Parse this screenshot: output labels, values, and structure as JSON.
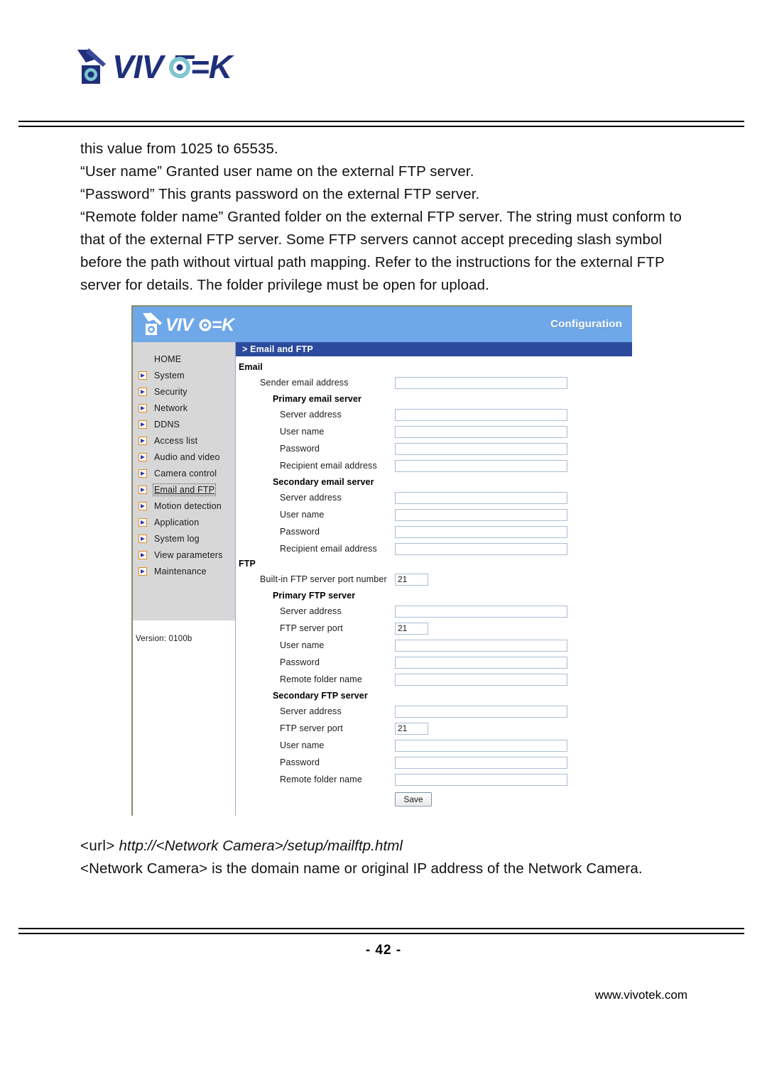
{
  "document": {
    "brand_logo_alt": "VIVOTEK",
    "body_paragraphs": [
      "this value from 1025 to 65535.",
      "“User name” Granted user name on the external FTP server.",
      "“Password” This grants password on the external FTP server.",
      "“Remote folder name” Granted folder on the external FTP server. The string must conform to that of the external FTP server. Some FTP servers cannot accept preceding slash symbol before the path without virtual path mapping. Refer to the instructions for the external FTP server for details. The folder privilege must be open for upload."
    ],
    "url_note": {
      "tag": "<url>",
      "value": "http://<Network Camera>/setup/mailftp.html"
    },
    "camera_note": "<Network Camera> is the domain name or original IP address of the Network Camera.",
    "page_number": "- 42 -",
    "website": "www.vivotek.com"
  },
  "app": {
    "brand": "VIVOTEK",
    "header_title": "Configuration",
    "breadcrumb": "> Email and FTP",
    "version": "Version: 0100b",
    "colors": {
      "header_blue": "#6fa8e8",
      "breadcrumb_navy": "#2b4a9b",
      "sidebar_gray": "#d7d7d7",
      "icon_orange": "#e08a1e",
      "icon_arrow_blue": "#2f3fa0",
      "input_border": "#a9bdd4"
    },
    "sidebar": {
      "items": [
        {
          "label": "HOME",
          "icon": "none",
          "selected": false
        },
        {
          "label": "System",
          "icon": "arrow-right-icon",
          "selected": false
        },
        {
          "label": "Security",
          "icon": "arrow-right-icon",
          "selected": false
        },
        {
          "label": "Network",
          "icon": "arrow-right-icon",
          "selected": false
        },
        {
          "label": "DDNS",
          "icon": "arrow-right-icon",
          "selected": false
        },
        {
          "label": "Access list",
          "icon": "arrow-right-icon",
          "selected": false
        },
        {
          "label": "Audio and video",
          "icon": "arrow-right-icon",
          "selected": false
        },
        {
          "label": "Camera control",
          "icon": "arrow-right-icon",
          "selected": false
        },
        {
          "label": "Email and FTP",
          "icon": "arrow-right-icon",
          "selected": true
        },
        {
          "label": "Motion detection",
          "icon": "arrow-right-icon",
          "selected": false
        },
        {
          "label": "Application",
          "icon": "arrow-right-icon",
          "selected": false
        },
        {
          "label": "System log",
          "icon": "arrow-right-icon",
          "selected": false
        },
        {
          "label": "View parameters",
          "icon": "arrow-right-icon",
          "selected": false
        },
        {
          "label": "Maintenance",
          "icon": "arrow-right-icon",
          "selected": false
        }
      ]
    },
    "form": {
      "email_section_title": "Email",
      "email_sender_label": "Sender email address",
      "email_sender_value": "",
      "primary_email_title": "Primary email server",
      "secondary_email_title": "Secondary email server",
      "email_fields": [
        {
          "label": "Server address",
          "value": ""
        },
        {
          "label": "User name",
          "value": ""
        },
        {
          "label": "Password",
          "value": ""
        },
        {
          "label": "Recipient email address",
          "value": ""
        }
      ],
      "ftp_section_title": "FTP",
      "builtin_ftp_label": "Built-in FTP server port number",
      "builtin_ftp_value": "21",
      "primary_ftp_title": "Primary FTP server",
      "secondary_ftp_title": "Secondary FTP server",
      "ftp_fields": [
        {
          "label": "Server address",
          "value": ""
        },
        {
          "label": "FTP server port",
          "value": "21"
        },
        {
          "label": "User name",
          "value": ""
        },
        {
          "label": "Password",
          "value": ""
        },
        {
          "label": "Remote folder name",
          "value": ""
        }
      ],
      "save_label": "Save"
    }
  }
}
